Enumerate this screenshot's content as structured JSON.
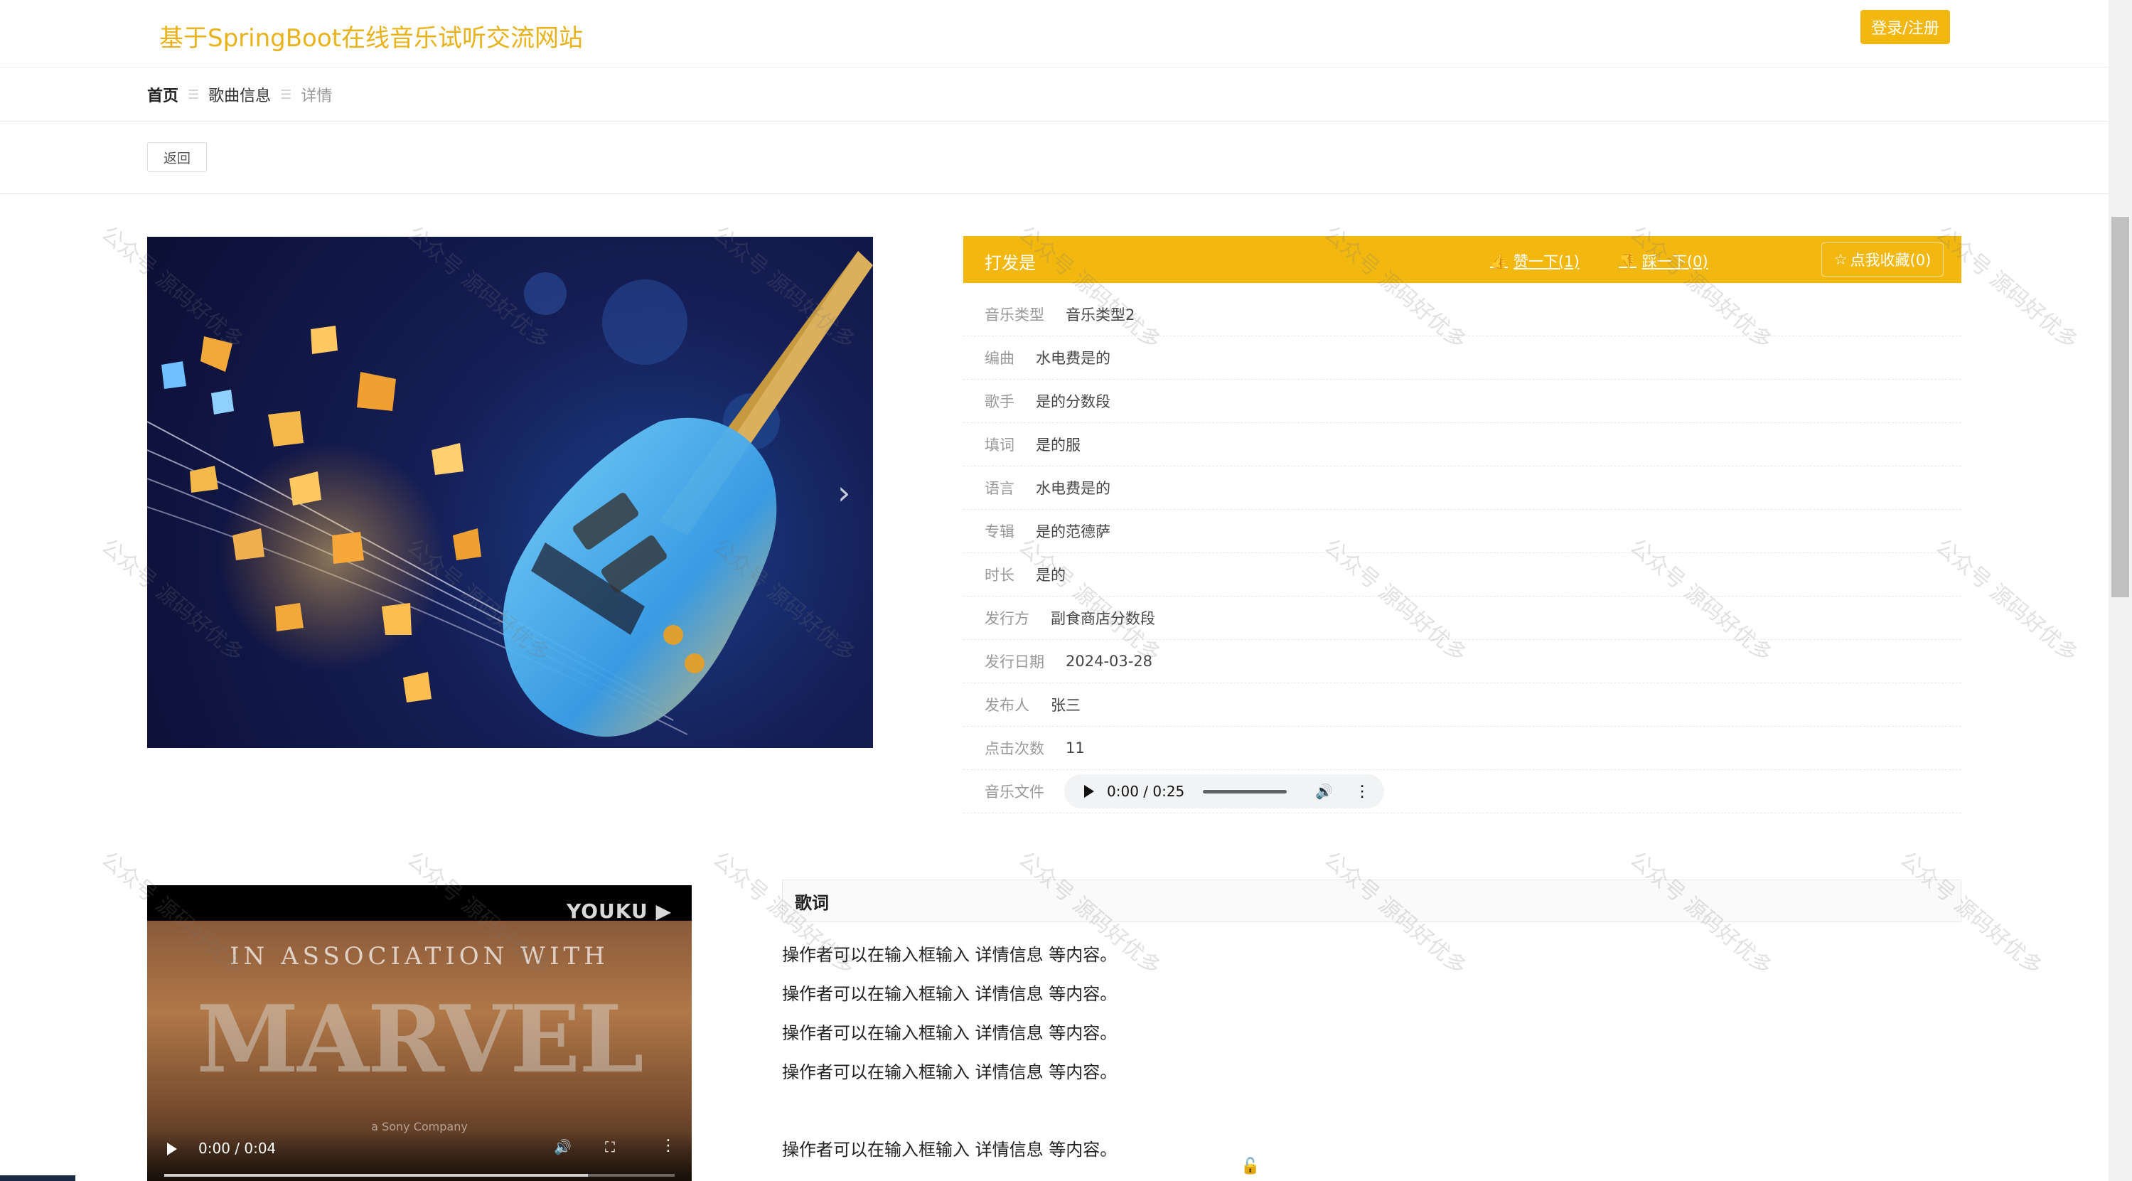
{
  "header": {
    "site_title": "基于SpringBoot在线音乐试听交流网站",
    "login_label": "登录/注册"
  },
  "breadcrumb": {
    "home": "首页",
    "category": "歌曲信息",
    "current": "详情",
    "separator": "☰"
  },
  "back_label": "返回",
  "song": {
    "name": "打发是",
    "like_label": "赞一下(1)",
    "dislike_label": "踩一下(0)",
    "favorite_label": "点我收藏(0)"
  },
  "details": [
    {
      "label": "音乐类型",
      "value": "音乐类型2"
    },
    {
      "label": "编曲",
      "value": "水电费是的"
    },
    {
      "label": "歌手",
      "value": "是的分数段"
    },
    {
      "label": "填词",
      "value": "是的服"
    },
    {
      "label": "语言",
      "value": "水电费是的"
    },
    {
      "label": "专辑",
      "value": "是的范德萨"
    },
    {
      "label": "时长",
      "value": "是的"
    },
    {
      "label": "发行方",
      "value": "副食商店分数段"
    },
    {
      "label": "发行日期",
      "value": "2024-03-28"
    },
    {
      "label": "发布人",
      "value": "张三"
    },
    {
      "label": "点击次数",
      "value": "11"
    },
    {
      "label": "音乐文件",
      "value": ""
    }
  ],
  "audio": {
    "time": "0:00 / 0:25"
  },
  "video": {
    "brand": "YOUKU ▶",
    "overlay_text": "IN ASSOCIATION WITH",
    "big_text": "MARVEL",
    "sub_text": "a Sony Company",
    "time": "0:00 / 0:04"
  },
  "lyrics": {
    "title": "歌词",
    "lines": [
      "操作者可以在输入框输入  详情信息  等内容。",
      "操作者可以在输入框输入  详情信息  等内容。",
      "操作者可以在输入框输入  详情信息  等内容。",
      "操作者可以在输入框输入  详情信息  等内容。",
      "操作者可以在输入框输入  详情信息  等内容。"
    ]
  },
  "watermark": "公众号 源码好优多",
  "colors": {
    "accent": "#f2b810",
    "title": "#e8b21a"
  }
}
